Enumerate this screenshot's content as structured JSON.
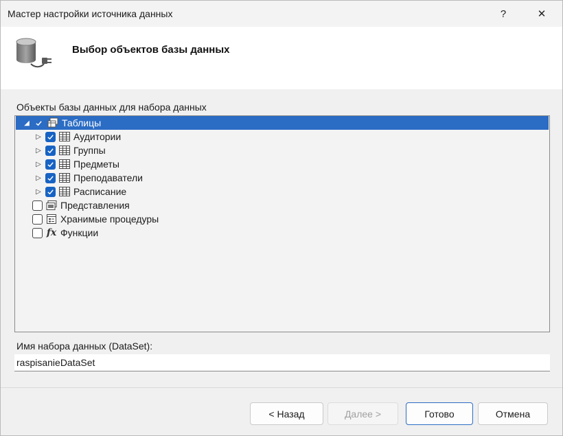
{
  "window": {
    "title": "Мастер настройки источника данных",
    "help_glyph": "?",
    "close_glyph": "✕"
  },
  "header": {
    "heading": "Выбор объектов базы данных",
    "icon": "database-plug-icon"
  },
  "objects": {
    "label": "Объекты базы данных для набора данных",
    "tree": [
      {
        "label": "Таблицы",
        "expander": "◢",
        "checked": true,
        "selected": true,
        "icon": "tables-icon"
      },
      {
        "label": "Аудитории",
        "expander": "▷",
        "checked": true,
        "icon": "table-icon"
      },
      {
        "label": "Группы",
        "expander": "▷",
        "checked": true,
        "icon": "table-icon"
      },
      {
        "label": "Предметы",
        "expander": "▷",
        "checked": true,
        "icon": "table-icon"
      },
      {
        "label": "Преподаватели",
        "expander": "▷",
        "checked": true,
        "icon": "table-icon"
      },
      {
        "label": "Расписание",
        "expander": "▷",
        "checked": true,
        "icon": "table-icon"
      },
      {
        "label": "Представления",
        "checked": false,
        "icon": "views-icon"
      },
      {
        "label": "Хранимые процедуры",
        "checked": false,
        "icon": "stored-procedures-icon"
      },
      {
        "label": "Функции",
        "checked": false,
        "icon": "functions-icon",
        "icon_text": "fx"
      }
    ]
  },
  "dataset": {
    "label": "Имя набора данных (DataSet):",
    "value": "raspisanieDataSet"
  },
  "buttons": {
    "back": "< Назад",
    "next": "Далее >",
    "finish": "Готово",
    "cancel": "Отмена"
  },
  "colors": {
    "selection": "#2b6cc4",
    "checkbox": "#1763c4"
  }
}
